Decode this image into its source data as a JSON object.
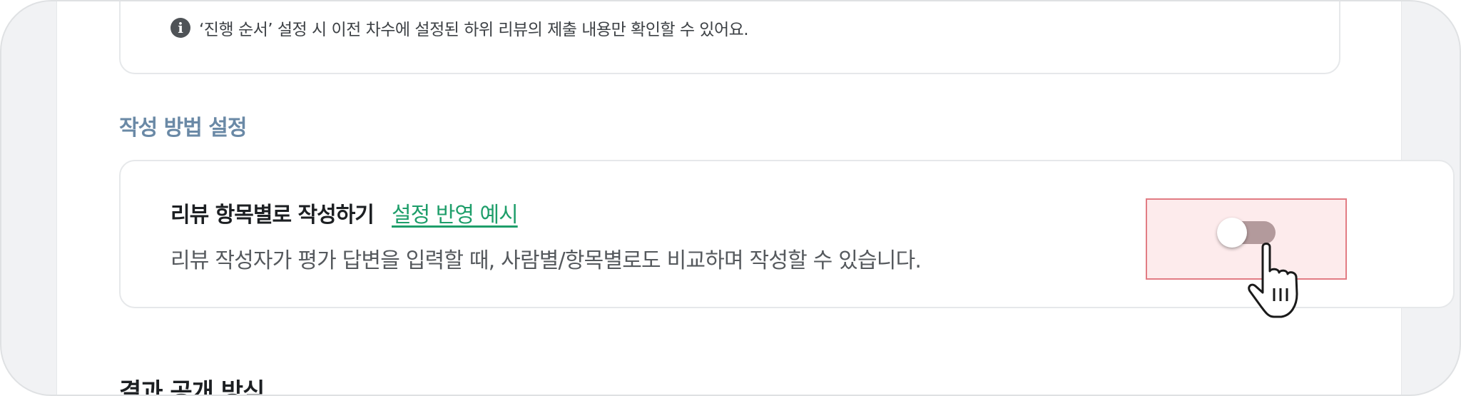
{
  "notice": {
    "icon": "info-icon",
    "text": "‘진행 순서’ 설정 시 이전 차수에 설정된 하위 리뷰의 제출 내용만 확인할 수 있어요."
  },
  "writing_method": {
    "section_title": "작성 방법 설정",
    "option": {
      "title": "리뷰 항목별로 작성하기",
      "example_link": "설정 반영 예시",
      "description": "리뷰 작성자가 평가 답변을 입력할 때, 사람별/항목별로도 비교하며 작성할 수 있습니다.",
      "toggle_on": false
    }
  },
  "next_section": {
    "title": "결과 공개 방식"
  },
  "colors": {
    "section_title": "#6a89a6",
    "link": "#1e9e6a",
    "highlight_border": "#e27c84",
    "toggle_track": "#b39a9c"
  }
}
